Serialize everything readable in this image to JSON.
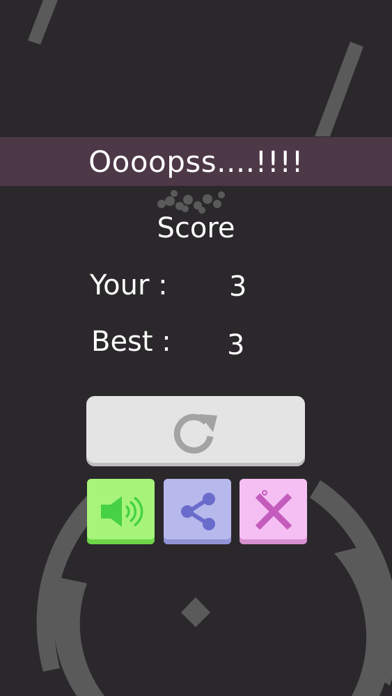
{
  "banner": {
    "text": "Oooopss....!!!!"
  },
  "score": {
    "title": "Score",
    "your_label": "Your :",
    "your_value": "3",
    "best_label": "Best :",
    "best_value": "3"
  },
  "buttons": {
    "replay_icon": "refresh-icon",
    "sound_icon": "speaker-icon",
    "share_icon": "share-icon",
    "close_icon": "close-x-icon"
  },
  "colors": {
    "background": "#2b282b",
    "banner": "#4d3847",
    "replay": "#e5e4e5",
    "sound": "#a6f57a",
    "share": "#b7b8ec",
    "close": "#f6bff3"
  }
}
